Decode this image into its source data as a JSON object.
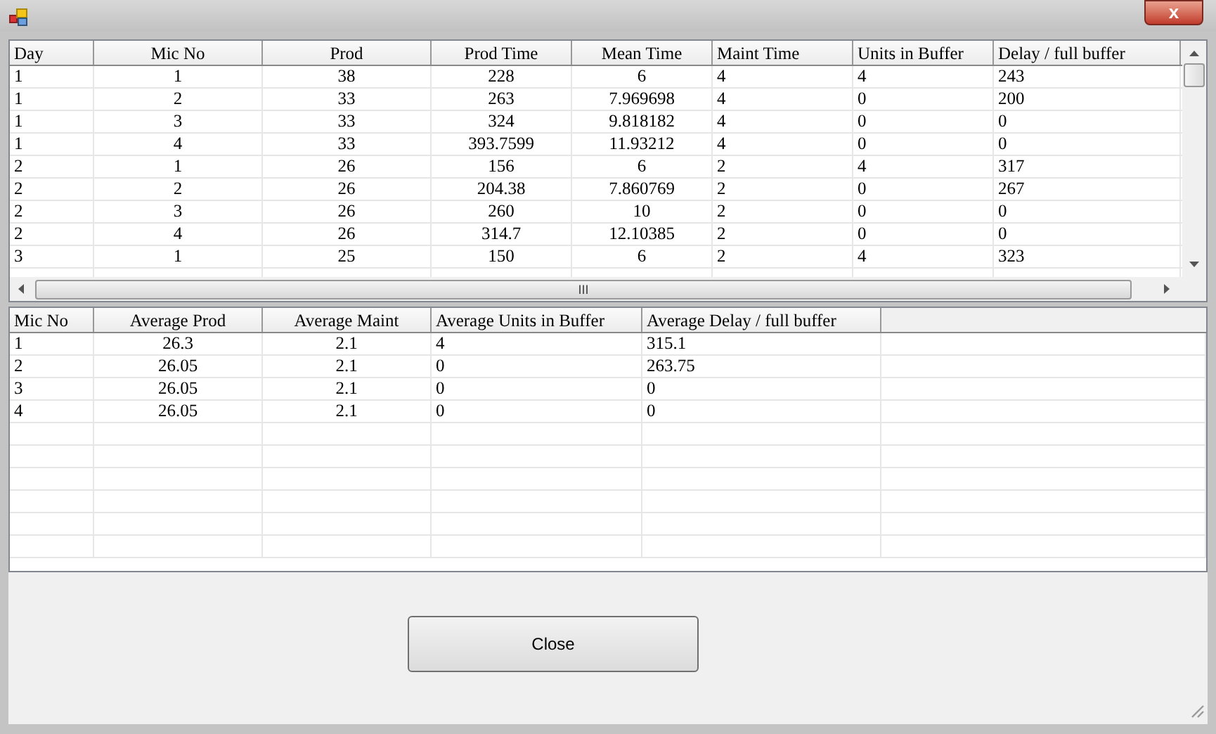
{
  "window": {
    "close_glyph": "x"
  },
  "details_table": {
    "columns": [
      "Day",
      "Mic No",
      "Prod",
      "Prod Time",
      "Mean Time",
      "Maint Time",
      "Units in Buffer",
      "Delay / full buffer"
    ],
    "rows": [
      [
        "1",
        "1",
        "38",
        "228",
        "6",
        "4",
        "4",
        "243"
      ],
      [
        "1",
        "2",
        "33",
        "263",
        "7.969698",
        "4",
        "0",
        "200"
      ],
      [
        "1",
        "3",
        "33",
        "324",
        "9.818182",
        "4",
        "0",
        "0"
      ],
      [
        "1",
        "4",
        "33",
        "393.7599",
        "11.93212",
        "4",
        "0",
        "0"
      ],
      [
        "2",
        "1",
        "26",
        "156",
        "6",
        "2",
        "4",
        "317"
      ],
      [
        "2",
        "2",
        "26",
        "204.38",
        "7.860769",
        "2",
        "0",
        "267"
      ],
      [
        "2",
        "3",
        "26",
        "260",
        "10",
        "2",
        "0",
        "0"
      ],
      [
        "2",
        "4",
        "26",
        "314.7",
        "12.10385",
        "2",
        "0",
        "0"
      ],
      [
        "3",
        "1",
        "25",
        "150",
        "6",
        "2",
        "4",
        "323"
      ]
    ],
    "scroll_thumb_glyph": "III"
  },
  "summary_table": {
    "columns": [
      "Mic No",
      "Average Prod",
      "Average Maint",
      "Average Units in Buffer",
      "Average Delay / full buffer"
    ],
    "rows": [
      [
        "1",
        "26.3",
        "2.1",
        "4",
        "315.1"
      ],
      [
        "2",
        "26.05",
        "2.1",
        "0",
        "263.75"
      ],
      [
        "3",
        "26.05",
        "2.1",
        "0",
        "0"
      ],
      [
        "4",
        "26.05",
        "2.1",
        "0",
        "0"
      ]
    ]
  },
  "close_button": {
    "label": "Close"
  }
}
